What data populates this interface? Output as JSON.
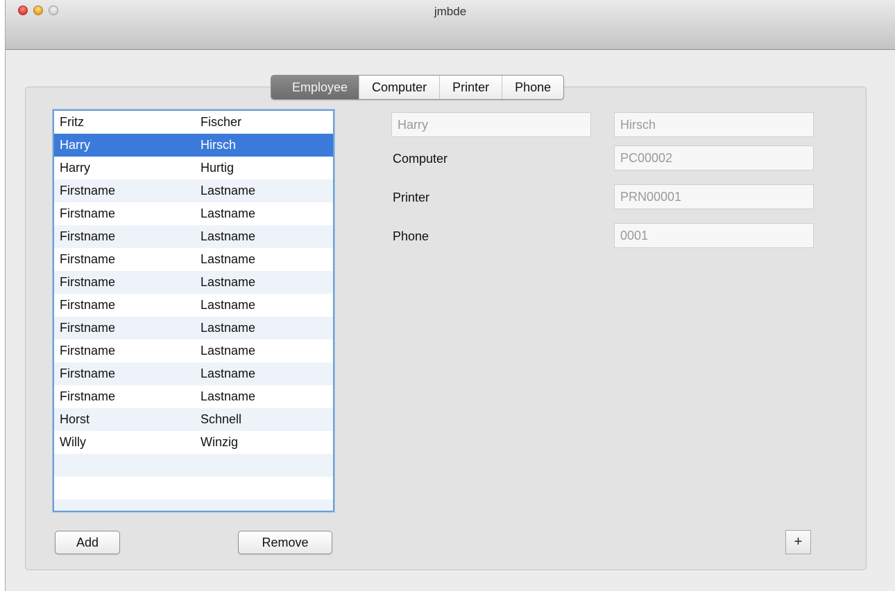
{
  "window": {
    "title": "jmbde"
  },
  "tabs": [
    {
      "label": "Employee",
      "active": true
    },
    {
      "label": "Computer",
      "active": false
    },
    {
      "label": "Printer",
      "active": false
    },
    {
      "label": "Phone",
      "active": false
    }
  ],
  "employees": [
    {
      "first": "Fritz",
      "last": "Fischer",
      "selected": false
    },
    {
      "first": "Harry",
      "last": "Hirsch",
      "selected": true
    },
    {
      "first": "Harry",
      "last": "Hurtig",
      "selected": false
    },
    {
      "first": "Firstname",
      "last": "Lastname",
      "selected": false
    },
    {
      "first": "Firstname",
      "last": "Lastname",
      "selected": false
    },
    {
      "first": "Firstname",
      "last": "Lastname",
      "selected": false
    },
    {
      "first": "Firstname",
      "last": "Lastname",
      "selected": false
    },
    {
      "first": "Firstname",
      "last": "Lastname",
      "selected": false
    },
    {
      "first": "Firstname",
      "last": "Lastname",
      "selected": false
    },
    {
      "first": "Firstname",
      "last": "Lastname",
      "selected": false
    },
    {
      "first": "Firstname",
      "last": "Lastname",
      "selected": false
    },
    {
      "first": "Firstname",
      "last": "Lastname",
      "selected": false
    },
    {
      "first": "Firstname",
      "last": "Lastname",
      "selected": false
    },
    {
      "first": "Horst",
      "last": "Schnell",
      "selected": false
    },
    {
      "first": "Willy",
      "last": "Winzig",
      "selected": false
    }
  ],
  "detail": {
    "firstname_value": "Harry",
    "lastname_value": "Hirsch",
    "computer_label": "Computer",
    "computer_value": "PC00002",
    "printer_label": "Printer",
    "printer_value": "PRN00001",
    "phone_label": "Phone",
    "phone_value": "0001"
  },
  "buttons": {
    "add_label": "Add",
    "remove_label": "Remove",
    "plus_label": "+"
  },
  "colors": {
    "selection": "#3b7ad9",
    "active_tab": "#7a7a7a"
  }
}
